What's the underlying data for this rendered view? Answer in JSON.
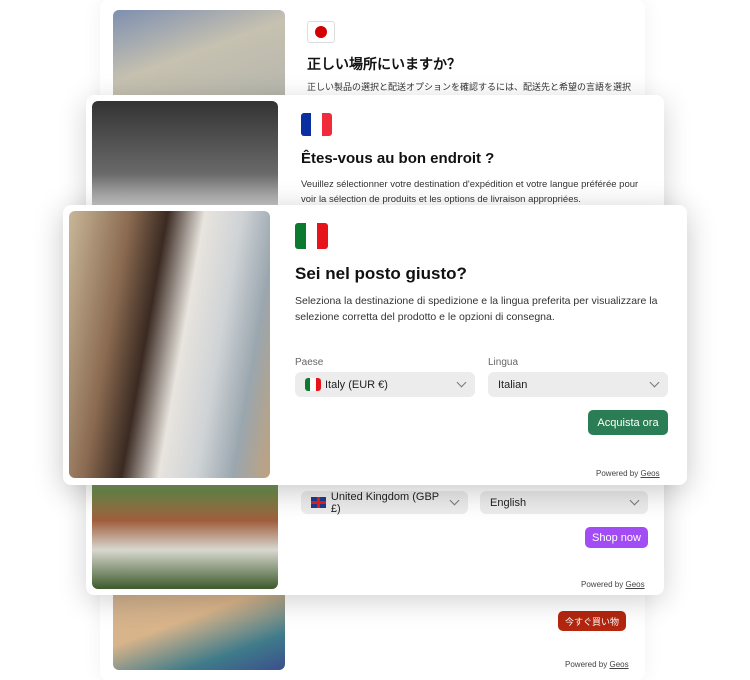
{
  "jp": {
    "title": "正しい場所にいますか？",
    "description": "正しい製品の選択と配送オプションを確認するには、配送先と希望の言語を選択",
    "button": "今すぐ買い物",
    "powered_by": "Powered by",
    "brand": "Geos",
    "accent": "#b3260f"
  },
  "fr": {
    "title": "Êtes-vous au bon endroit ?",
    "description": "Veuillez sélectionner votre destination d'expédition et votre langue préférée pour voir la sélection de produits et les options de livraison appropriées.",
    "country_value": "United Kingdom (GBP £)",
    "language_value": "English",
    "button": "Shop now",
    "powered_by": "Powered by",
    "brand": "Geos",
    "accent": "#a24cf5"
  },
  "it": {
    "title": "Sei nel posto giusto?",
    "description": "Seleziona la destinazione di spedizione e la lingua preferita per visualizzare la selezione corretta del prodotto e le opzioni di consegna.",
    "country_label": "Paese",
    "country_value": "Italy (EUR €)",
    "language_label": "Lingua",
    "language_value": "Italian",
    "button": "Acquista ora",
    "powered_by": "Powered by",
    "brand": "Geos",
    "accent": "#2a7d55"
  }
}
